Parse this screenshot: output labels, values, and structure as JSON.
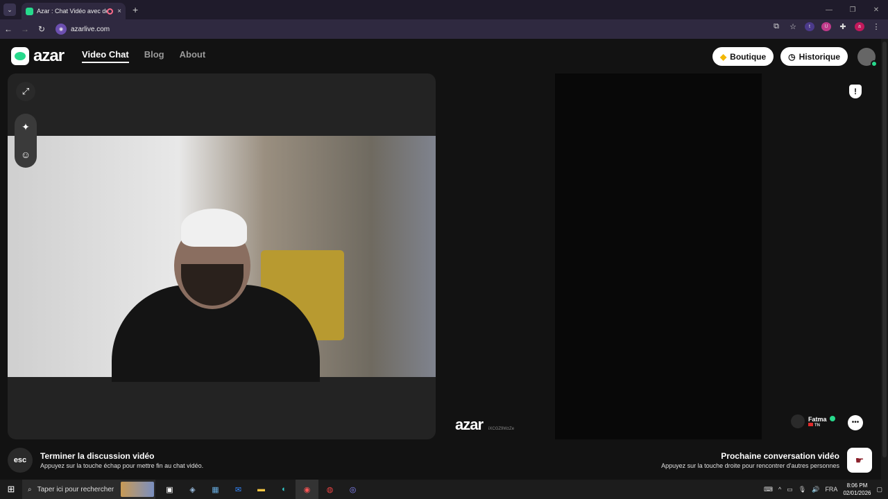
{
  "browser": {
    "tab_title": "Azar : Chat Vidéo avec de n",
    "tab_close": "×",
    "new_tab": "+",
    "tab_list": "⌄",
    "url": "azarlive.com",
    "window_controls": [
      "—",
      "❐",
      "✕"
    ],
    "ext_letters": [
      "t",
      "U",
      "a"
    ]
  },
  "header": {
    "logo_text": "azar",
    "nav": [
      "Video Chat",
      "Blog",
      "About"
    ],
    "boutique_label": "Boutique",
    "historique_label": "Historique"
  },
  "remote": {
    "watermark": "azar",
    "watermark_id": "iXCGZ9WzZe",
    "peer_name": "Fatma",
    "peer_country": "TN"
  },
  "bottom": {
    "esc_label": "esc",
    "end_title": "Terminer la discussion vidéo",
    "end_desc": "Appuyez sur la touche échap pour mettre fin au chat vidéo.",
    "next_title": "Prochaine conversation vidéo",
    "next_desc": "Appuyez sur la touche droite pour rencontrer d'autres personnes"
  },
  "taskbar": {
    "search_placeholder": "Taper ici pour rechercher",
    "language": "FRA",
    "time": "8:06 PM",
    "date": "02/01/2026"
  },
  "colors": {
    "brand_green": "#27d98c",
    "tab_bar": "#1f1b2b",
    "page_bg": "#121212"
  }
}
